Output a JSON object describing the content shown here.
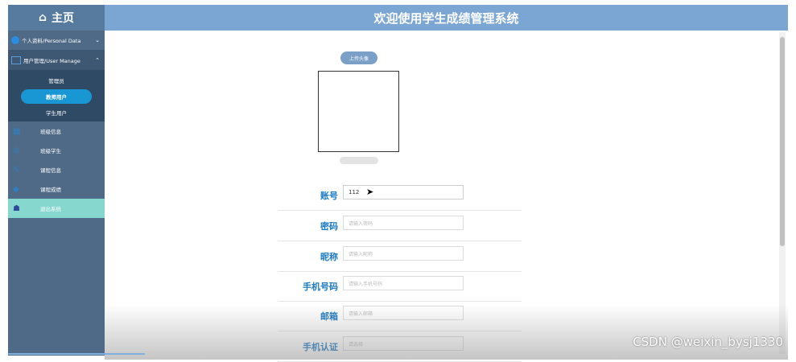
{
  "sidebar": {
    "home_label": "主页",
    "home_icon": "home-icon",
    "personal": "个人资料/Personal Data",
    "user_manage": "用户管理/User Manage",
    "sub_items": [
      "管理员",
      "教师用户",
      "学生用户"
    ],
    "active_sub_index": 1,
    "nav_items": [
      "班级信息",
      "班级学生",
      "课程信息",
      "课程成绩",
      "退出系统"
    ]
  },
  "header": {
    "title": "欢迎使用学生成绩管理系统"
  },
  "form": {
    "upload_label": "上传头像",
    "fields": [
      {
        "label": "账号",
        "value": "112",
        "placeholder": ""
      },
      {
        "label": "密码",
        "value": "",
        "placeholder": "请输入密码"
      },
      {
        "label": "昵称",
        "value": "",
        "placeholder": "请输入昵称"
      },
      {
        "label": "手机号码",
        "value": "",
        "placeholder": "请输入手机号码"
      },
      {
        "label": "邮箱",
        "value": "",
        "placeholder": "请输入邮箱"
      },
      {
        "label": "手机认证",
        "value": "",
        "placeholder": "请选择"
      }
    ]
  },
  "watermark": "CSDN @weixin_bysj1330",
  "colors": {
    "accent": "#1996d4",
    "header": "#7ba6d3",
    "sidebar": "#4f6a86",
    "label": "#1b79c4"
  }
}
